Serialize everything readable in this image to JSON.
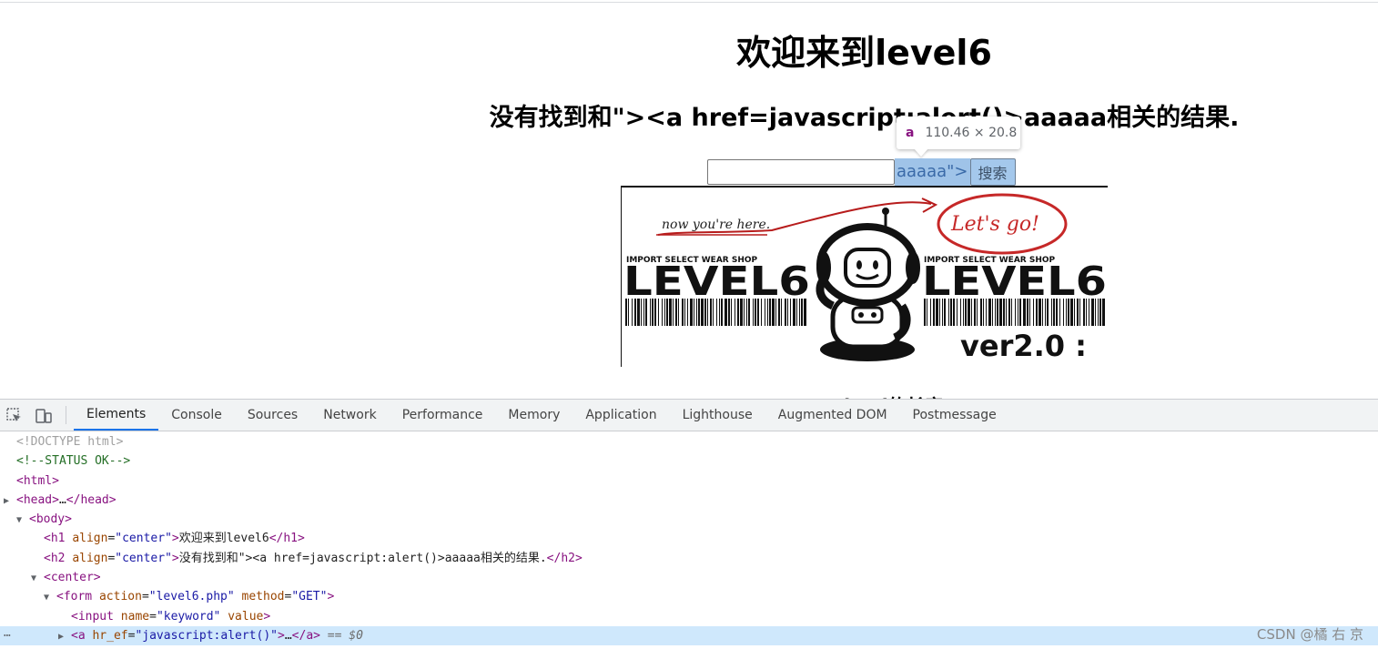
{
  "page": {
    "h1": "欢迎来到level6",
    "h2": "没有找到和\"><a href=javascript:alert()>aaaaa相关的结果.",
    "input_value": "",
    "link_text": "aaaaa\">",
    "search_button": "搜索",
    "cut_text": "payload的长度:"
  },
  "tooltip": {
    "tag": "a",
    "dimensions": "110.46 × 20.8"
  },
  "banner": {
    "handwriting_left": "now you're here.",
    "handwriting_right": "Let's go!",
    "shop_text": "IMPORT SELECT WEAR SHOP",
    "level_text": "LEVEL6",
    "version_text": "ver2.0 :"
  },
  "devtools": {
    "tabs": [
      "Elements",
      "Console",
      "Sources",
      "Network",
      "Performance",
      "Memory",
      "Application",
      "Lighthouse",
      "Augmented DOM",
      "Postmessage"
    ],
    "active_tab": "Elements"
  },
  "dom": {
    "doctype": "<!DOCTYPE html>",
    "comment": "<!--STATUS OK-->",
    "html_open": "<html>",
    "head": "head",
    "head_ellipsis": "…",
    "body": "body",
    "h1_tag": "h1",
    "h1_attr": "align",
    "h1_val": "\"center\"",
    "h1_text": "欢迎来到level6",
    "h2_tag": "h2",
    "h2_attr": "align",
    "h2_val": "\"center\"",
    "h2_text": "没有找到和\"><a href=javascript:alert()>aaaaa相关的结果.",
    "center": "center",
    "form_tag": "form",
    "form_attr1": "action",
    "form_val1": "\"level6.php\"",
    "form_attr2": "method",
    "form_val2": "\"GET\"",
    "input_tag": "input",
    "input_attr1": "name",
    "input_val1": "\"keyword\"",
    "input_attr2": "value",
    "a_tag": "a",
    "a_attr": "hr_ef",
    "a_val": "\"javascript:alert()\"",
    "a_ellipsis": "…",
    "eq0": "== $0"
  },
  "watermark": "CSDN @橘 右 京"
}
